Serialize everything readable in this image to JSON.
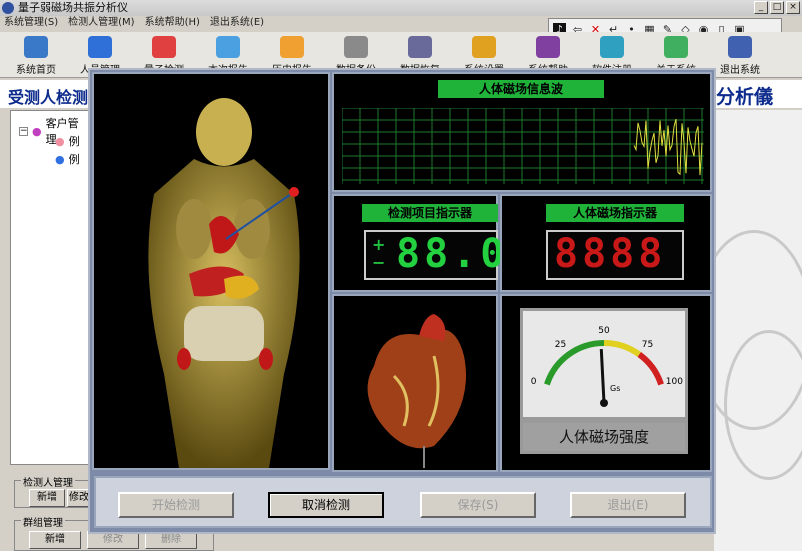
{
  "window": {
    "title": "量子弱磁场共振分析仪",
    "buttons": [
      "_",
      "□",
      "×"
    ]
  },
  "menu": [
    "系统管理(S)",
    "检测人管理(M)",
    "系统帮助(H)",
    "退出系统(E)"
  ],
  "toolbar": {
    "items": [
      {
        "label": "系统首页",
        "icon": "monitor-icon",
        "color": "#3a78c8"
      },
      {
        "label": "人员管理",
        "icon": "people-icon",
        "color": "#2f6fd8"
      },
      {
        "label": "量子检测",
        "icon": "network-icon",
        "color": "#e04040"
      },
      {
        "label": "本次报告",
        "icon": "report-icon",
        "color": "#4aa0e0"
      },
      {
        "label": "历史报告",
        "icon": "history-icon",
        "color": "#f0a030"
      },
      {
        "label": "数据备份",
        "icon": "backup-icon",
        "color": "#8a8a8a"
      },
      {
        "label": "数据恢复",
        "icon": "restore-icon",
        "color": "#6a6a9a"
      },
      {
        "label": "系统设置",
        "icon": "settings-icon",
        "color": "#e0a020"
      },
      {
        "label": "系统帮助",
        "icon": "help-icon",
        "color": "#8040a0"
      },
      {
        "label": "软件注册",
        "icon": "register-icon",
        "color": "#30a0c0"
      },
      {
        "label": "关于系统",
        "icon": "about-icon",
        "color": "#40b060"
      },
      {
        "label": "退出系统",
        "icon": "exit-icon",
        "color": "#4060b0"
      }
    ]
  },
  "quickbar_icons": [
    "note-icon",
    "back-icon",
    "close-icon",
    "enter-icon",
    "dot-icon",
    "grid-icon",
    "edit-icon",
    "erase-icon",
    "eye-icon",
    "mouse-icon",
    "disk-icon"
  ],
  "header": {
    "left": "受测人检测",
    "right": "分析儀"
  },
  "tree": {
    "root": "客户管理",
    "children": [
      "例",
      "例"
    ]
  },
  "groups": [
    {
      "title": "检测人管理",
      "buttons": [
        "新增",
        "修改"
      ]
    },
    {
      "title": "群组管理",
      "buttons": [
        "新增",
        "修改",
        "删除"
      ]
    }
  ],
  "dialog": {
    "wave_title": "人体磁场信息波",
    "item_indicator_title": "检测项目指示器",
    "item_indicator_value": "88.0",
    "item_indicator_sign": "+\n−",
    "field_indicator_title": "人体磁场指示器",
    "field_indicator_value": "8888",
    "gauge": {
      "label": "人体磁场强度",
      "ticks": [
        "0",
        "25",
        "50",
        "75",
        "100"
      ],
      "unit": "Gs",
      "value": 48
    },
    "buttons": {
      "start": "开始检测",
      "cancel": "取消检测",
      "save": "保存(S)",
      "exit": "退出(E)"
    }
  }
}
